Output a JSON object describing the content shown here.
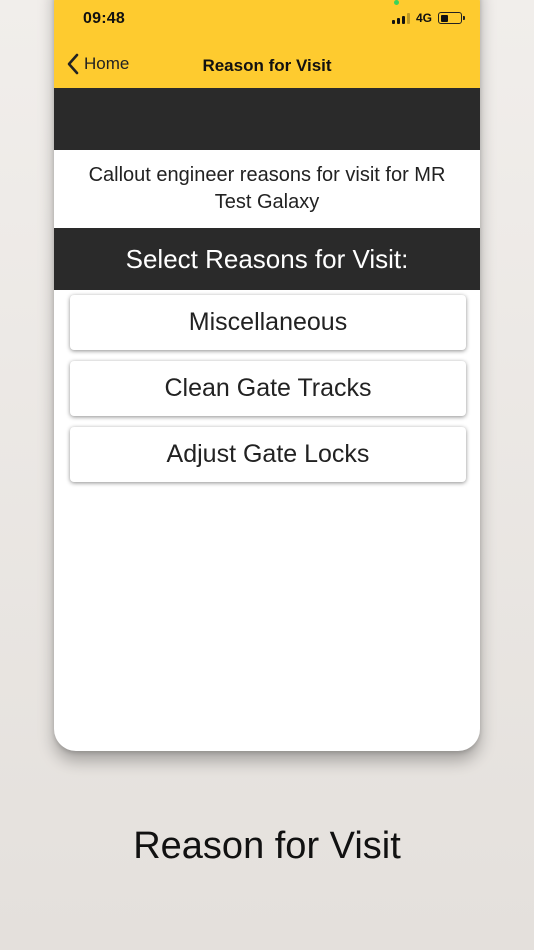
{
  "status_bar": {
    "time": "09:48",
    "network": "4G",
    "battery_level": 0.4
  },
  "nav": {
    "back_label": "Home",
    "title": "Reason for Visit"
  },
  "intro_text": "Callout engineer reasons for visit for MR Test Galaxy",
  "section_header": "Select Reasons for Visit:",
  "reasons": [
    {
      "label": "Miscellaneous"
    },
    {
      "label": "Clean Gate Tracks"
    },
    {
      "label": "Adjust Gate Locks"
    }
  ],
  "caption": "Reason for Visit",
  "colors": {
    "accent": "#fecb2f",
    "dark_bar": "#2a2a2a"
  }
}
